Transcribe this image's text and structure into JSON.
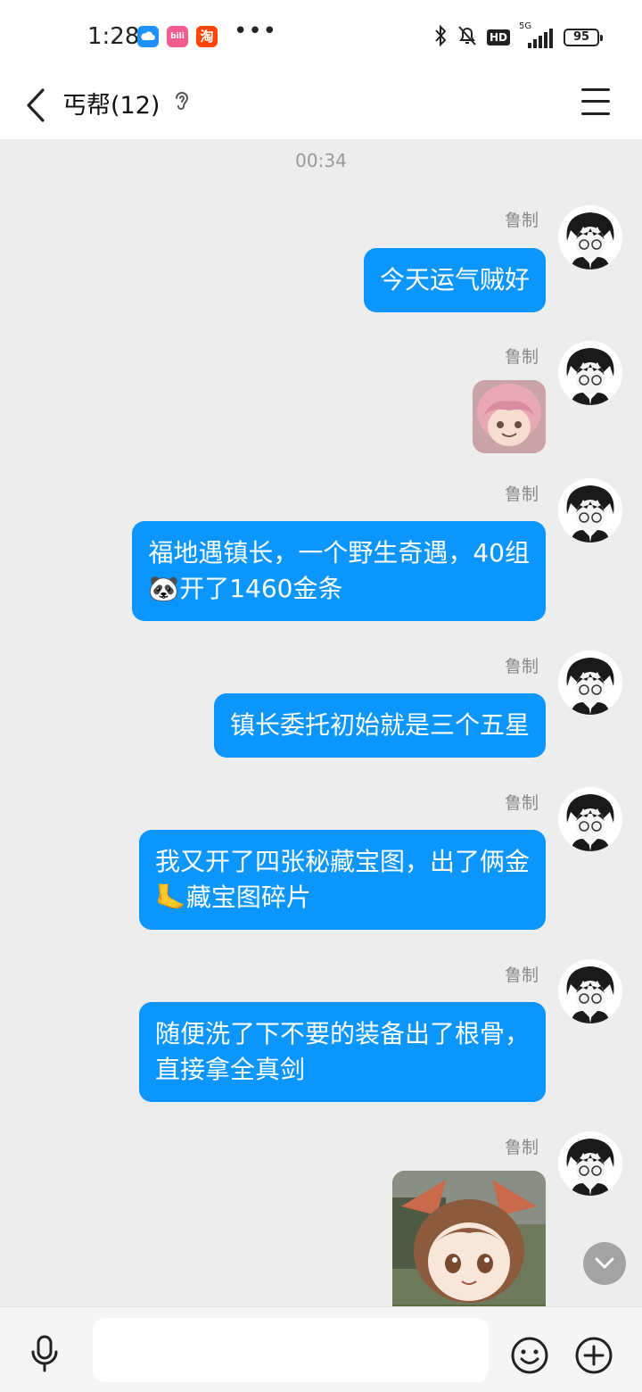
{
  "status_bar": {
    "time": "1:28",
    "app_icons": [
      {
        "name": "cloud-app-icon",
        "label": "",
        "color": "#1e90ff"
      },
      {
        "name": "bilibili-app-icon",
        "label": "bili",
        "color": "#f25d8e"
      },
      {
        "name": "taobao-app-icon",
        "label": "淘",
        "color": "#ff4400"
      }
    ],
    "more": "•••",
    "network_type": "5G",
    "battery": "95"
  },
  "header": {
    "back_icon": "chevron-left-icon",
    "title": "丐帮(12)",
    "ear_icon": "ear-icon",
    "menu_icon": "hamburger-menu-icon"
  },
  "chat": {
    "timestamp": "00:34",
    "messages": [
      {
        "sender": "鲁制",
        "type": "text",
        "text": "今天运气贼好"
      },
      {
        "sender": "鲁制",
        "type": "sticker",
        "sticker": "pink-hair-anime-girl-sticker"
      },
      {
        "sender": "鲁制",
        "type": "text",
        "lines": [
          "福地遇镇长，一个野生奇遇，40组",
          "🐼开了1460金条"
        ]
      },
      {
        "sender": "鲁制",
        "type": "text",
        "text": "镇长委托初始就是三个五星"
      },
      {
        "sender": "鲁制",
        "type": "text",
        "lines": [
          "我又开了四张秘藏宝图，出了俩金",
          "🦶藏宝图碎片"
        ]
      },
      {
        "sender": "鲁制",
        "type": "text",
        "lines": [
          "随便洗了下不要的装备出了根骨，",
          "直接拿全真剑"
        ]
      },
      {
        "sender": "鲁制",
        "type": "sticker",
        "sticker": "brown-hair-anime-girl-sticker"
      }
    ]
  },
  "input_bar": {
    "voice_icon": "microphone-icon",
    "placeholder": "",
    "emoji_icon": "smiley-icon",
    "plus_icon": "plus-circle-icon"
  },
  "colors": {
    "bubble": "#0a95ff",
    "chat_background": "#ededed"
  }
}
